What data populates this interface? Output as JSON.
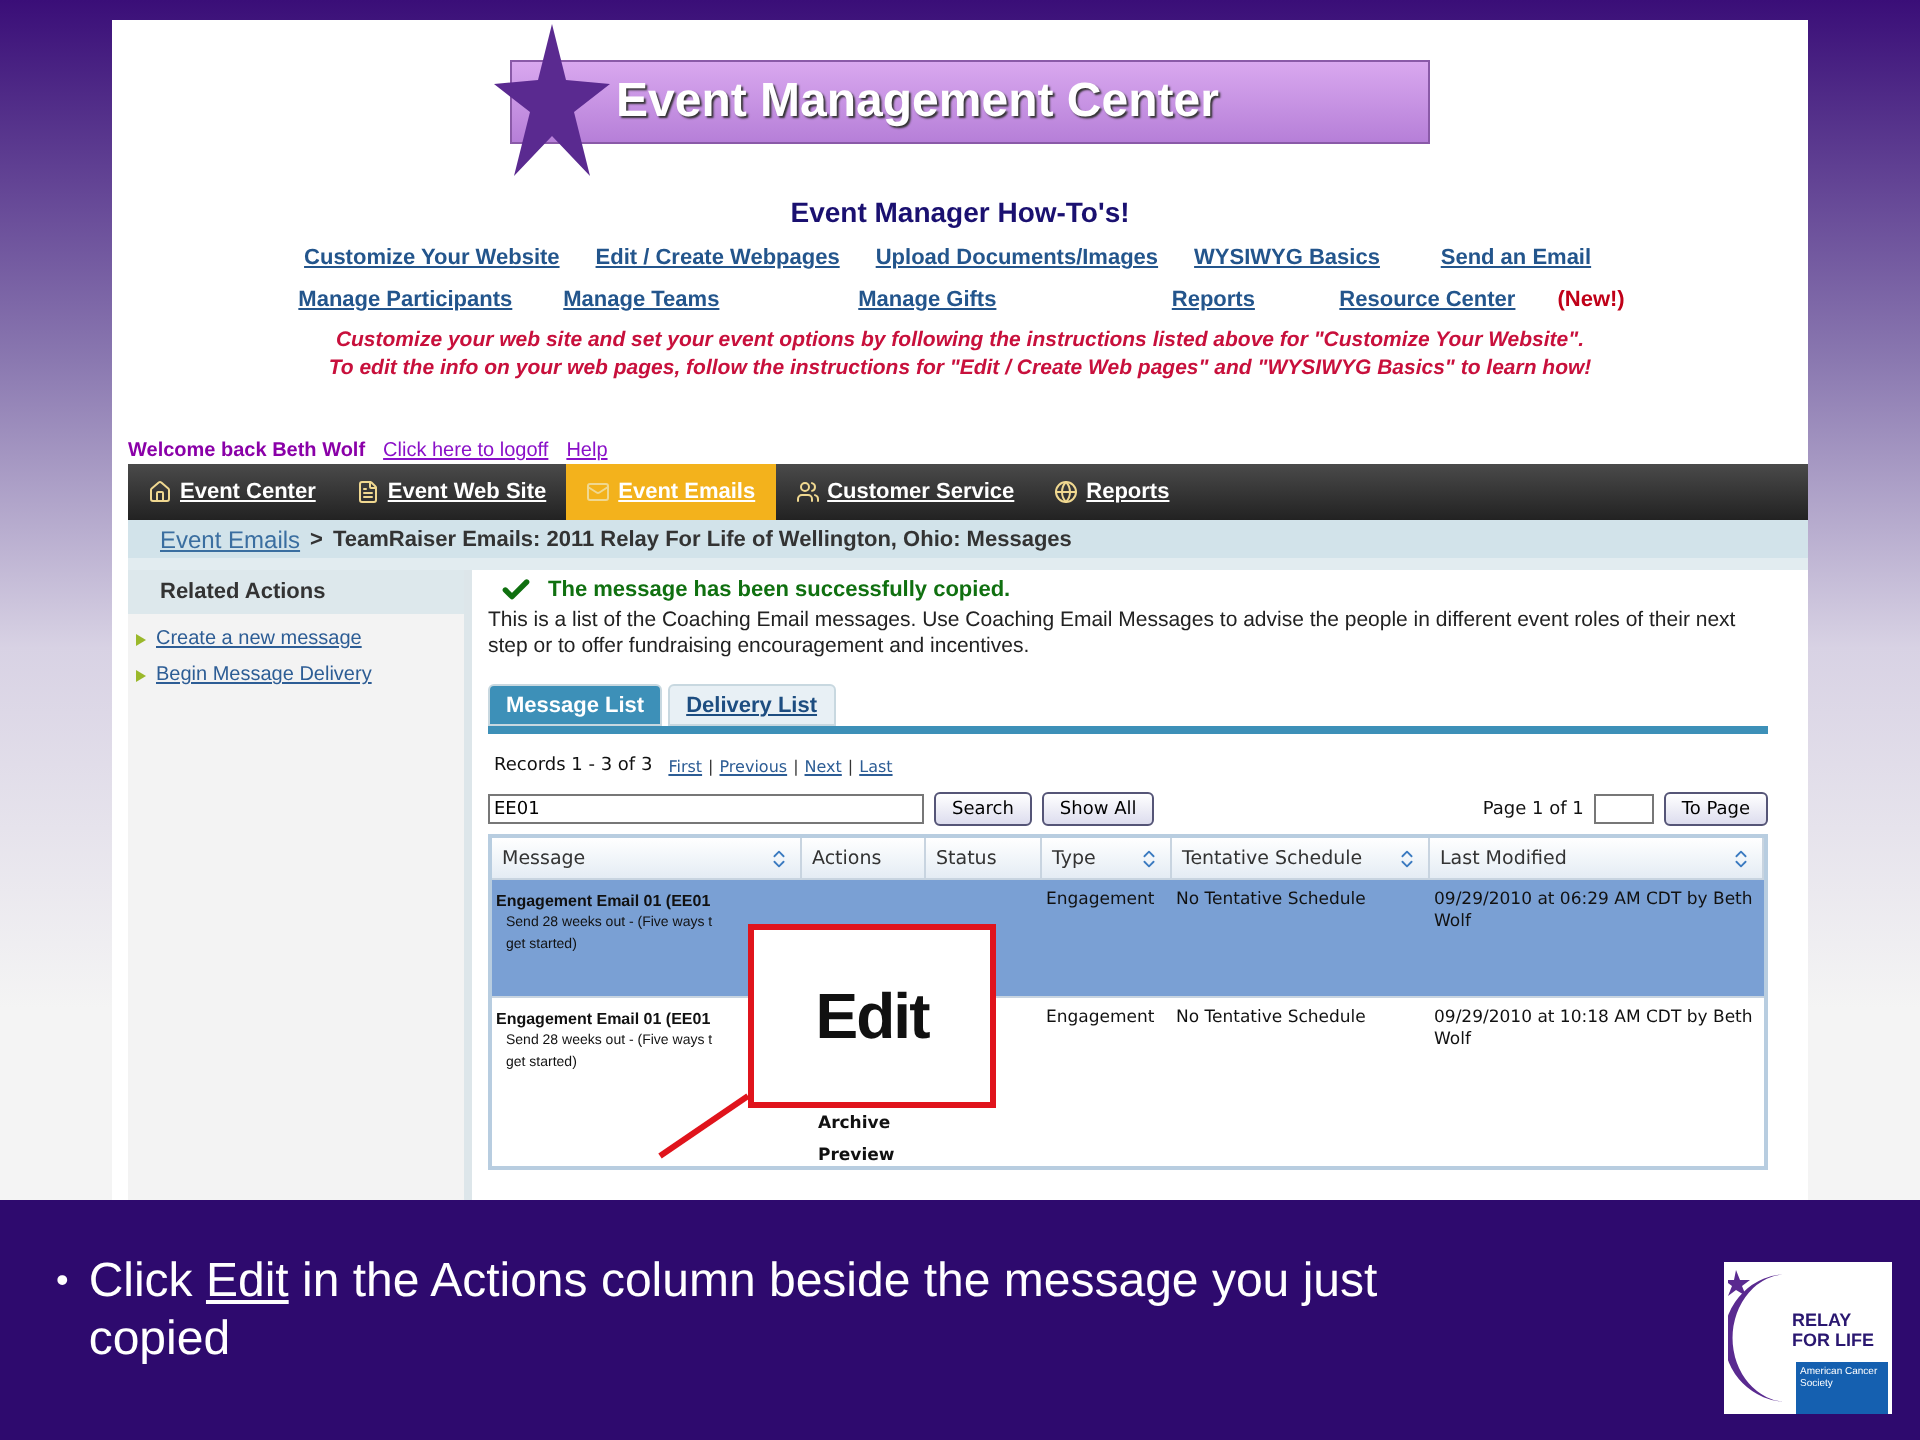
{
  "header": {
    "banner_title": "Event Management Center"
  },
  "howto": {
    "title": "Event Manager How-To's!",
    "link_rows": [
      [
        "Customize Your Website",
        "Edit / Create Webpages",
        "Upload Documents/Images",
        "WYSIWYG Basics",
        "Send an Email"
      ],
      [
        "Manage Participants",
        "Manage Teams",
        "Manage Gifts",
        "Reports",
        "Resource Center"
      ]
    ],
    "new_badge": "(New!)",
    "instructions": [
      "Customize your web site and set your event options by following the instructions listed above for \"Customize Your Website\".",
      "To edit the info on your web pages, follow the instructions for \"Edit / Create Web pages\" and \"WYSIWYG Basics\" to learn how!"
    ]
  },
  "welcome": {
    "text": "Welcome back Beth Wolf",
    "links": [
      "Click here to logoff",
      "Help"
    ]
  },
  "nav": [
    {
      "label": "Event Center",
      "selected": false
    },
    {
      "label": "Event Web Site",
      "selected": false
    },
    {
      "label": "Event Emails",
      "selected": true
    },
    {
      "label": "Customer Service",
      "selected": false
    },
    {
      "label": "Reports",
      "selected": false
    }
  ],
  "breadcrumb": {
    "link": "Event Emails",
    "separator": ">",
    "current": "TeamRaiser Emails: 2011 Relay For Life of Wellington, Ohio: Messages"
  },
  "sidebar": {
    "title": "Related Actions",
    "items": [
      "Create a new message",
      "Begin Message Delivery"
    ]
  },
  "main": {
    "success": "The message has been successfully copied.",
    "description": "This is a list of the Coaching Email messages. Use Coaching Email Messages to advise the people in different event roles of their next step or to offer fundraising encouragement and incentives.",
    "tabs": [
      {
        "label": "Message List",
        "selected": true
      },
      {
        "label": "Delivery List",
        "selected": false
      }
    ],
    "records": "Records 1 - 3 of 3",
    "pager": [
      "First",
      "Previous",
      "Next",
      "Last"
    ],
    "pager_separator": "|",
    "search_value": "EE01",
    "buttons": [
      "Search",
      "Show All"
    ],
    "page_label": "Page 1 of 1",
    "to_page": "To Page",
    "columns": [
      {
        "label": "Message",
        "sortable": true
      },
      {
        "label": "Actions",
        "sortable": false
      },
      {
        "label": "Status",
        "sortable": false
      },
      {
        "label": "Type",
        "sortable": true
      },
      {
        "label": "Tentative Schedule",
        "sortable": true
      },
      {
        "label": "Last Modified",
        "sortable": true
      }
    ],
    "rows": [
      {
        "selected": true,
        "message": "Engagement Email 01 (EE01",
        "note_lines": [
          "Send 28 weeks out - (Five ways t",
          "get started)"
        ],
        "actions": [],
        "type": "Engagement",
        "schedule": "No Tentative Schedule",
        "modified": "09/29/2010 at 06:29 AM CDT by Beth Wolf"
      },
      {
        "selected": false,
        "message": "Engagement Email 01 (EE01",
        "note_lines": [
          "Send 28 weeks out - (Five ways t",
          "get started)"
        ],
        "actions": [
          "Archive",
          "Preview"
        ],
        "type": "Engagement",
        "schedule": "No Tentative Schedule",
        "modified": "09/29/2010 at 10:18 AM CDT by Beth Wolf"
      }
    ]
  },
  "callout": {
    "text": "Edit"
  },
  "caption": {
    "bullet": "•",
    "before": "Click",
    "link": "Edit",
    "after": "in the Actions column beside the message you just copied"
  },
  "logo": {
    "line1": "RELAY",
    "line2": "FOR LIFE",
    "society": "American Cancer Society"
  }
}
